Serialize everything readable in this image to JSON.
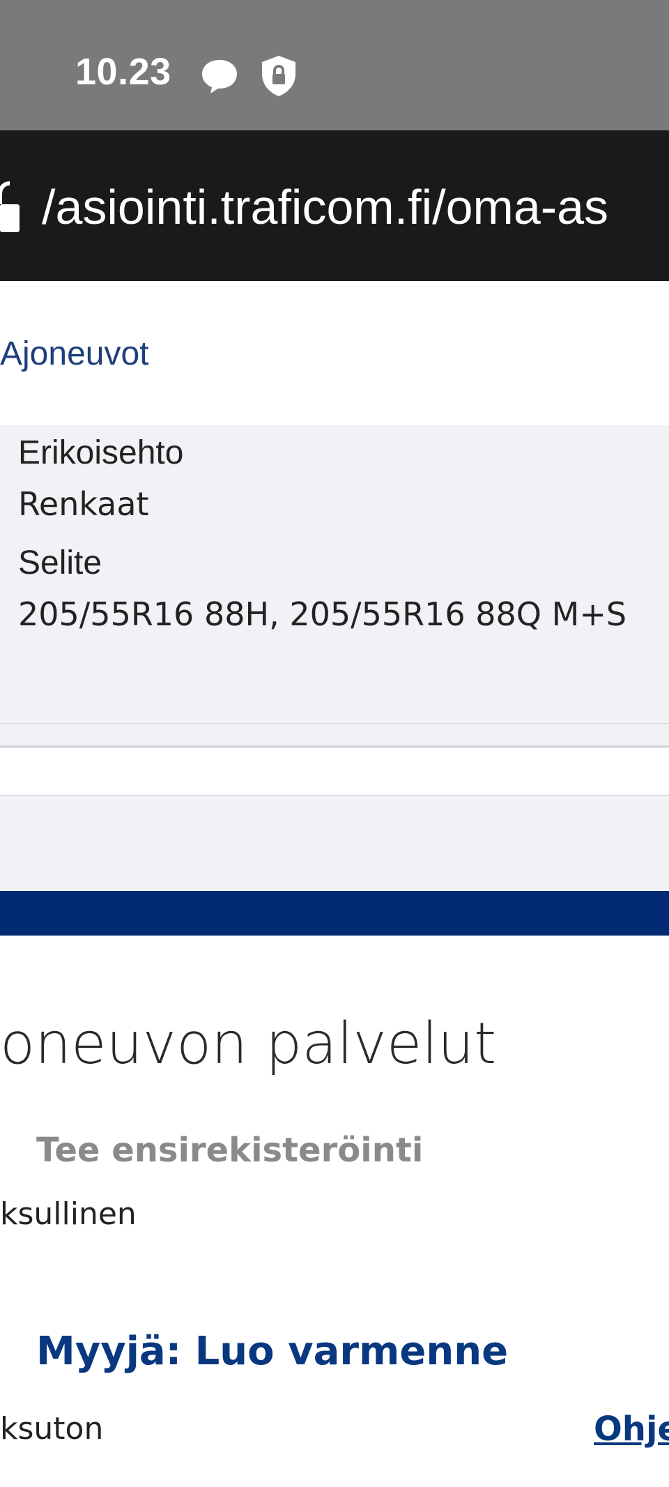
{
  "status_bar": {
    "time": "10.23",
    "icons": [
      "chat-icon",
      "shield-icon"
    ],
    "background": "#7a7a7a"
  },
  "browser": {
    "url": "/asiointi.traficom.fi/oma-as",
    "lock_icon": "lock-icon"
  },
  "breadcrumb": {
    "link": "Ajoneuvot"
  },
  "details": [
    {
      "label": "Erikoisehto",
      "value": "Renkaat"
    },
    {
      "label": "Selite",
      "value": "205/55R16 88H, 205/55R16 88Q M+S"
    }
  ],
  "services": {
    "title": "oneuvon palvelut",
    "items": [
      {
        "name": "Tee ensirekisteröinti",
        "fee": "ksullinen",
        "enabled": false
      },
      {
        "name": "Myyjä: Luo varmenne",
        "fee": "ksuton",
        "enabled": true,
        "help_label": "Ohje"
      }
    ]
  },
  "colors": {
    "brand_blue": "#002b73",
    "link_blue": "#0a3880",
    "panel_gray": "#f1f2f5"
  }
}
